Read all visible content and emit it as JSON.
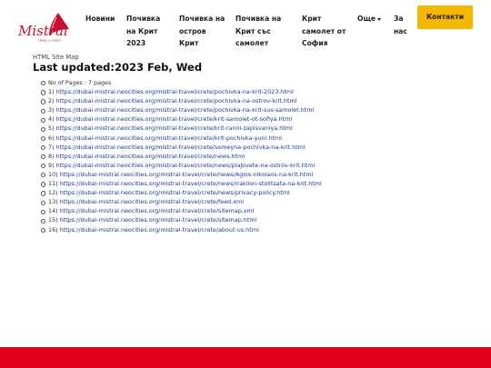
{
  "brand": {
    "logo_text": "Mistral",
    "logo_tagline": "TRAVEL & EVENTS",
    "accent_color": "#c8102e"
  },
  "nav": {
    "items": [
      {
        "lines": [
          "Новини"
        ]
      },
      {
        "lines": [
          "Почивка",
          "на Крит",
          "2023"
        ]
      },
      {
        "lines": [
          "Почивка на",
          "остров",
          "Крит"
        ]
      },
      {
        "lines": [
          "Почивка на",
          "Крит със",
          "самолет"
        ]
      },
      {
        "lines": [
          "Крит",
          "самолет от",
          "София"
        ]
      },
      {
        "lines": [
          "Още"
        ]
      },
      {
        "lines": [
          "За",
          "нас"
        ]
      }
    ],
    "contact_label": "Контакти",
    "contact_color": "#f5b800"
  },
  "breadcrumb": "HTML Site Map",
  "title": "Last updated:2023 Feb, Wed",
  "pages_info": "No of Pages : 7 pages",
  "links": [
    {
      "num": "1)",
      "url": "https://dubai-mistral.neocities.org/mistral-travel/crete/pochivka-na-krit-2023.html"
    },
    {
      "num": "2)",
      "url": "https://dubai-mistral.neocities.org/mistral-travel/crete/pochivka-na-ostrov-krit.html"
    },
    {
      "num": "3)",
      "url": "https://dubai-mistral.neocities.org/mistral-travel/crete/pochivka-na-krit-sus-samolet.html"
    },
    {
      "num": "4)",
      "url": "https://dubai-mistral.neocities.org/mistral-travel/crete/krit-samolet-ot-sofiya.html"
    },
    {
      "num": "5)",
      "url": "https://dubai-mistral.neocities.org/mistral-travel/crete/krit-ranni-zapisvaniya.html"
    },
    {
      "num": "6)",
      "url": "https://dubai-mistral.neocities.org/mistral-travel/crete/krit-pochivka-yuni.html"
    },
    {
      "num": "7)",
      "url": "https://dubai-mistral.neocities.org/mistral-travel/crete/semeyna-pochivka-na-krit.html"
    },
    {
      "num": "8)",
      "url": "https://dubai-mistral.neocities.org/mistral-travel/crete/news.html"
    },
    {
      "num": "9)",
      "url": "https://dubai-mistral.neocities.org/mistral-travel/crete/news/plajovete-na-ostrov-krit.html"
    },
    {
      "num": "10)",
      "url": "https://dubai-mistral.neocities.org/mistral-travel/crete/news/Agios-nikolaos-na-krit.html"
    },
    {
      "num": "11)",
      "url": "https://dubai-mistral.neocities.org/mistral-travel/crete/news/iraklion-stolitsata-na-krit.html"
    },
    {
      "num": "12)",
      "url": "https://dubai-mistral.neocities.org/mistral-travel/crete/news/privacy-policy.html"
    },
    {
      "num": "13)",
      "url": "https://dubai-mistral.neocities.org/mistral-travel/crete/feed.xml"
    },
    {
      "num": "14)",
      "url": "https://dubai-mistral.neocities.org/mistral-travel/crete/sitemap.xml"
    },
    {
      "num": "15)",
      "url": "https://dubai-mistral.neocities.org/mistral-travel/crete/sitemap.html"
    },
    {
      "num": "16)",
      "url": "https://dubai-mistral.neocities.org/mistral-travel/crete/about-us.html"
    }
  ],
  "footer": {
    "color": "#e3001b"
  }
}
